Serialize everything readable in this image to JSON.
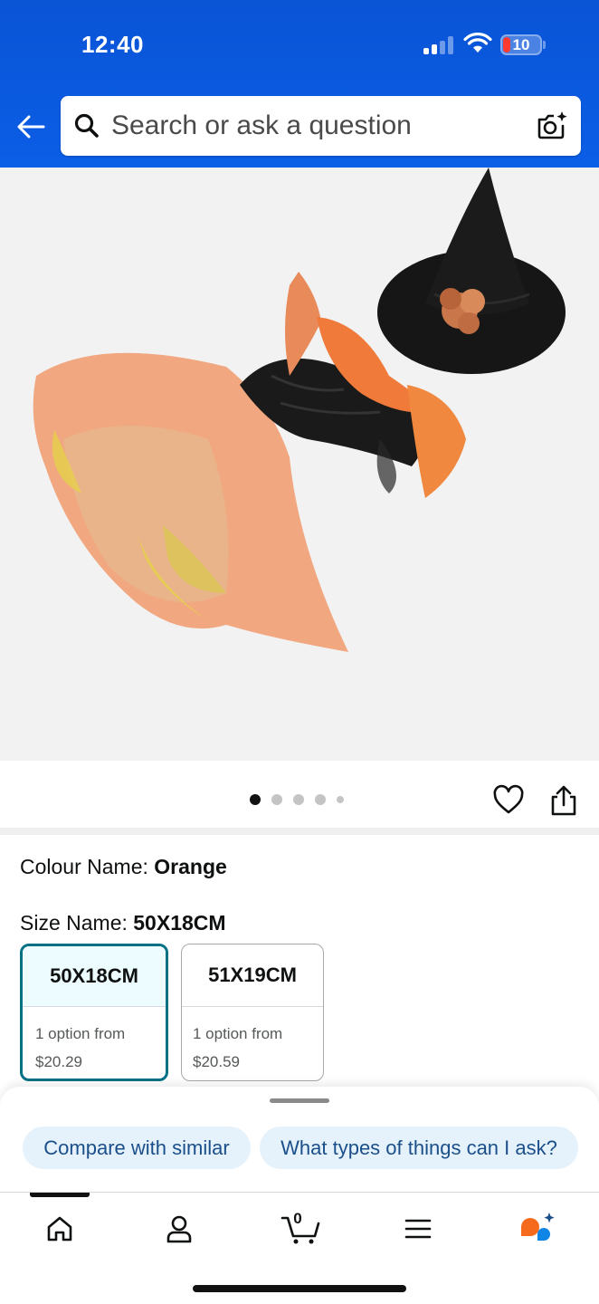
{
  "status_bar": {
    "time": "12:40",
    "battery": "10"
  },
  "search": {
    "placeholder": "Search or ask a question"
  },
  "product": {
    "image_count": 5,
    "active_image": 1,
    "colour_label": "Colour Name: ",
    "colour_value": "Orange",
    "size_label": "Size Name: ",
    "size_value": "50X18CM"
  },
  "sizes": [
    {
      "name": "50X18CM",
      "line1": "1 option from",
      "price": "$20.29",
      "selected": true
    },
    {
      "name": "51X19CM",
      "line1": "1 option from",
      "price": "$20.59",
      "selected": false
    }
  ],
  "chips": [
    {
      "label": "Compare with similar"
    },
    {
      "label": "What types of things can I ask?"
    }
  ],
  "tabbar": {
    "cart_count": "0",
    "active_tab": "home"
  },
  "colors": {
    "header_blue": "#0b5ee6",
    "accent_teal": "#007185",
    "chip_bg": "#e6f2fb",
    "chip_text": "#1a4f8a"
  },
  "icons": [
    "back-arrow-icon",
    "search-icon",
    "camera-icon",
    "heart-icon",
    "share-icon",
    "home-icon",
    "account-icon",
    "cart-icon",
    "menu-icon",
    "rufus-icon"
  ]
}
